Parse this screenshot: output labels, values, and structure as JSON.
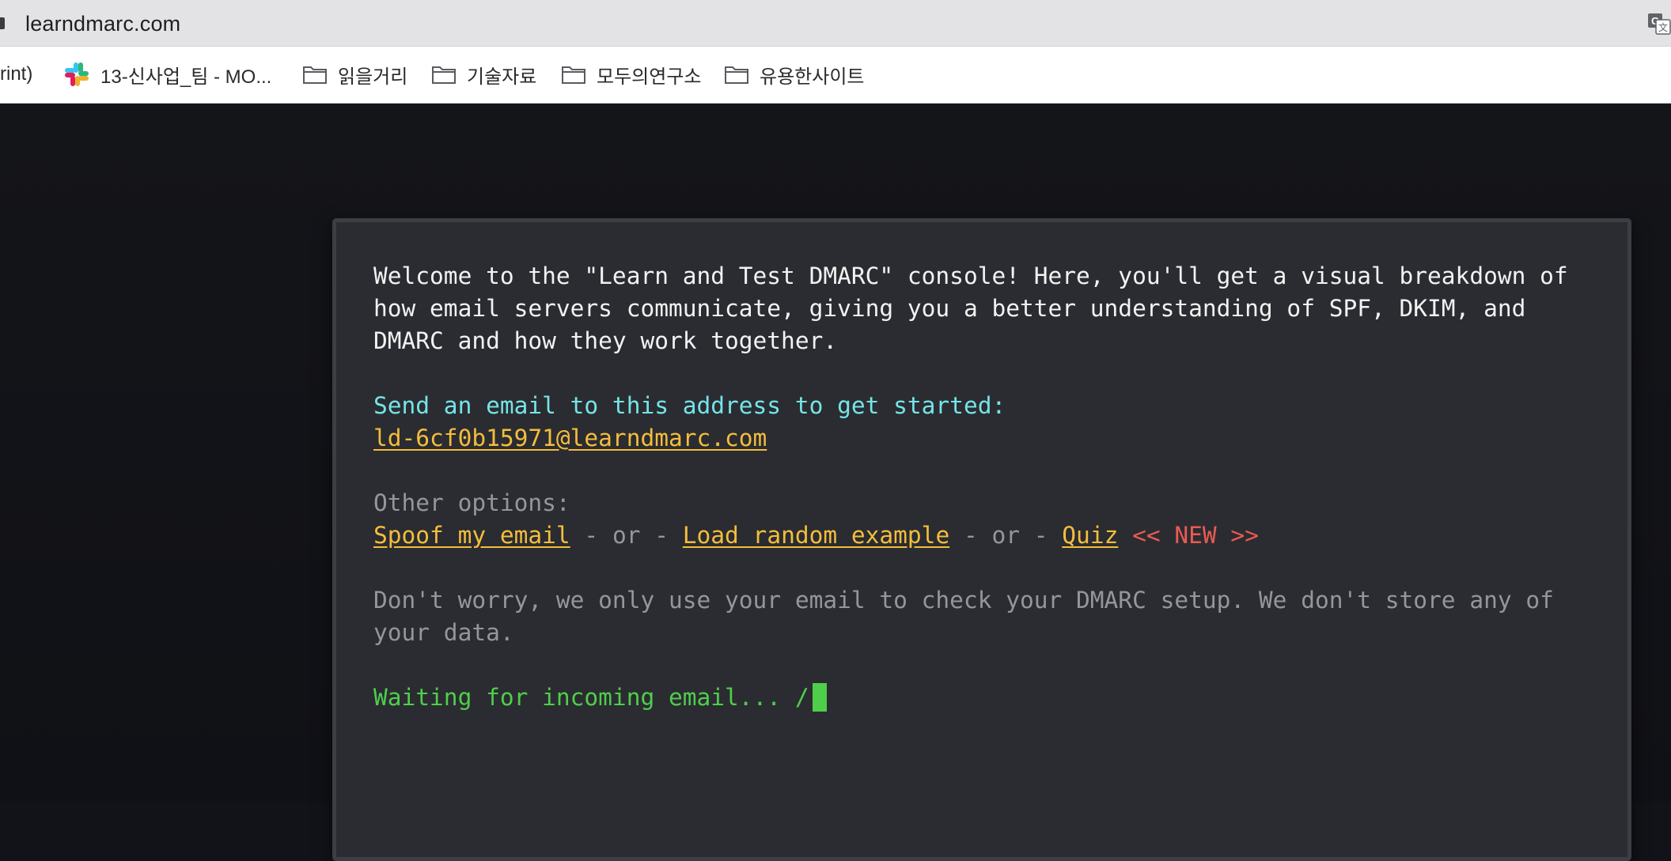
{
  "browser": {
    "url": "learndmarc.com",
    "bookmarks": [
      {
        "label": "rint)",
        "icon": "none"
      },
      {
        "label": "13-신사업_팀 - MO...",
        "icon": "slack-icon"
      },
      {
        "label": "읽을거리",
        "icon": "folder-icon"
      },
      {
        "label": "기술자료",
        "icon": "folder-icon"
      },
      {
        "label": "모두의연구소",
        "icon": "folder-icon"
      },
      {
        "label": "유용한사이트",
        "icon": "folder-icon"
      }
    ]
  },
  "console": {
    "welcome_line1": "Welcome to the \"Learn and Test DMARC\" console! Here, you'll get a visual breakdown of",
    "welcome_line2": "how email servers communicate, giving you a better understanding of SPF, DKIM, and",
    "welcome_line3": "DMARC and how they work together.",
    "send_prompt": "Send an email to this address to get started:",
    "email_address": "ld-6cf0b15971@learndmarc.com",
    "other_options_label": "Other options:",
    "spoof_link": "Spoof my email",
    "separator1": " - or - ",
    "random_link": "Load random example",
    "separator2": " - or - ",
    "quiz_link": "Quiz",
    "new_badge": " << NEW >>",
    "privacy_line1": "Don't worry, we only use your email to check your DMARC setup. We don't store any of",
    "privacy_line2": "your data.",
    "waiting_text": "Waiting for incoming email... /"
  },
  "colors": {
    "background": "#121318",
    "console_bg": "#2b2c31",
    "text": "#f2f2f2",
    "cyan": "#74e5e8",
    "muted": "#95969c",
    "link": "#f3be3c",
    "new_badge": "#ec5a52",
    "status": "#4fce4c"
  }
}
